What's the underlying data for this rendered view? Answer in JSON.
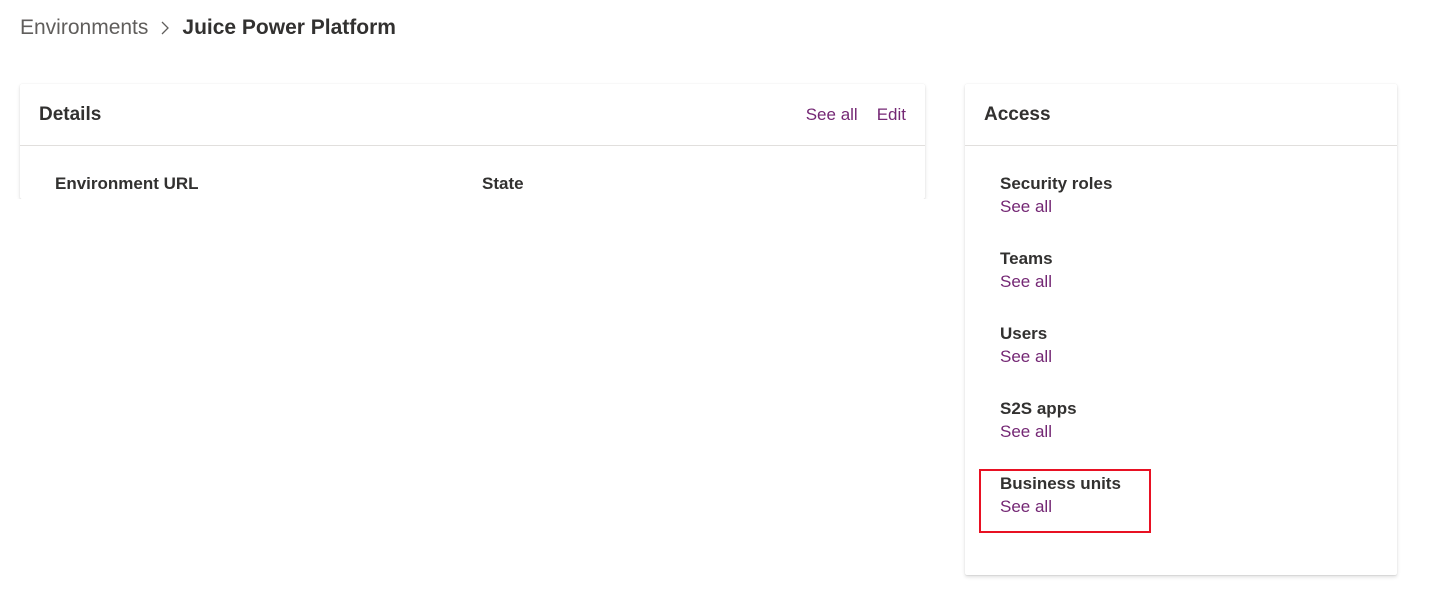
{
  "breadcrumb": {
    "parent": "Environments",
    "current": "Juice Power Platform"
  },
  "details": {
    "title": "Details",
    "see_all_label": "See all",
    "edit_label": "Edit",
    "fields": [
      {
        "label": "Environment URL"
      },
      {
        "label": "State"
      }
    ]
  },
  "access": {
    "title": "Access",
    "items": [
      {
        "label": "Security roles",
        "link": "See all"
      },
      {
        "label": "Teams",
        "link": "See all"
      },
      {
        "label": "Users",
        "link": "See all"
      },
      {
        "label": "S2S apps",
        "link": "See all"
      },
      {
        "label": "Business units",
        "link": "See all"
      }
    ]
  },
  "colors": {
    "link": "#742774",
    "text": "#323130",
    "highlight": "#e81123"
  },
  "icons": {
    "breadcrumb_separator": "chevron-right-icon"
  }
}
